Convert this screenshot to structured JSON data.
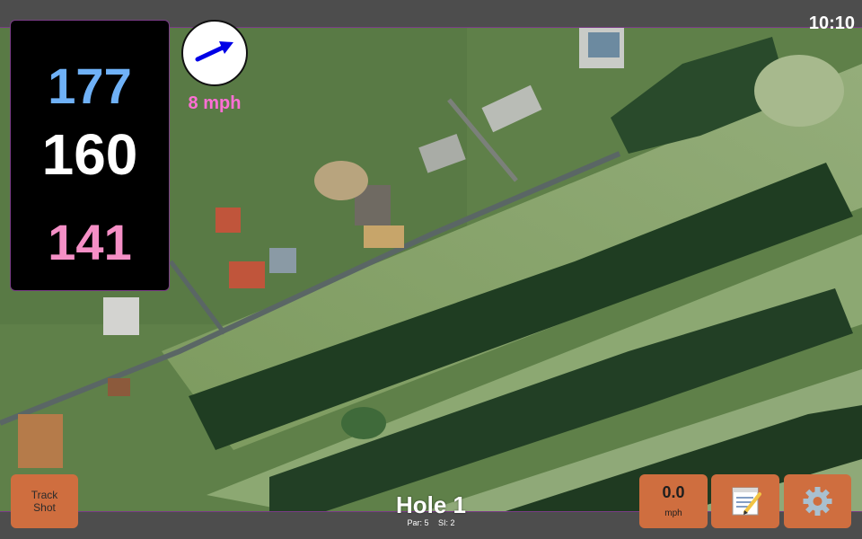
{
  "status_bar": {
    "time": "10:10"
  },
  "yardages": {
    "back": "177",
    "center": "160",
    "front": "141",
    "colors": {
      "back": "#6fb1f7",
      "center": "#ffffff",
      "front": "#f58fc6"
    }
  },
  "wind": {
    "speed_label": "8 mph",
    "direction_icon": "arrow-icon",
    "arrow_color": "#0000e6"
  },
  "track_shot": {
    "line1": "Track",
    "line2": "Shot"
  },
  "hole": {
    "title": "Hole 1",
    "par_label": "Par: 5",
    "si_label": "SI: 2"
  },
  "player_speed": {
    "value": "0.0",
    "unit": "mph"
  },
  "notes_button": {
    "icon": "notepad-icon"
  },
  "settings_button": {
    "icon": "gear-icon"
  },
  "colors": {
    "button": "#cf6e3f",
    "accent_border": "#7a3c86"
  }
}
